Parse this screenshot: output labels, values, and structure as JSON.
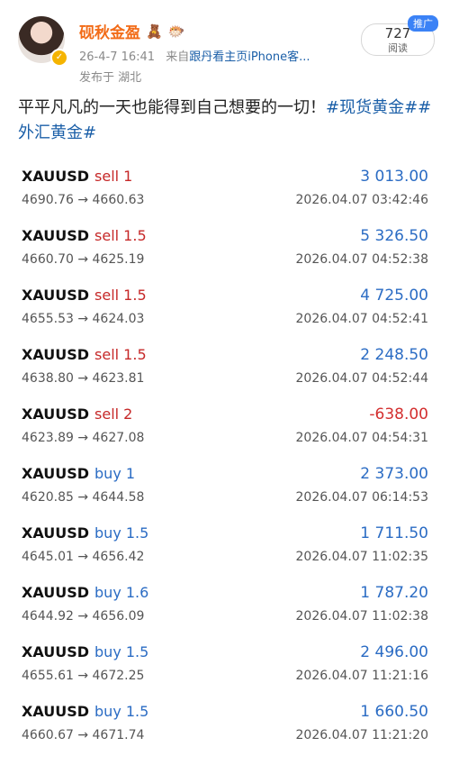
{
  "user": {
    "name": "砚秋金盈",
    "emoji1": "🧸",
    "emoji2": "🐡",
    "post_time": "26-4-7 16:41",
    "source_prefix": "来自",
    "source": "跟丹看主页iPhone客...",
    "location": "发布于 湖北"
  },
  "reads": {
    "count": "727",
    "label": "阅读",
    "badge": "推广"
  },
  "post": {
    "text": "平平凡凡的一天也能得到自己想要的一切！",
    "tags": "#现货黄金##外汇黄金#"
  },
  "trades": [
    {
      "symbol": "XAUUSD",
      "action": "sell 1",
      "type": "sell",
      "profit": "3 013.00",
      "prices": "4690.76 → 4660.63",
      "time": "2026.04.07 03:42:46"
    },
    {
      "symbol": "XAUUSD",
      "action": "sell 1.5",
      "type": "sell",
      "profit": "5 326.50",
      "prices": "4660.70 → 4625.19",
      "time": "2026.04.07 04:52:38"
    },
    {
      "symbol": "XAUUSD",
      "action": "sell 1.5",
      "type": "sell",
      "profit": "4 725.00",
      "prices": "4655.53 → 4624.03",
      "time": "2026.04.07 04:52:41"
    },
    {
      "symbol": "XAUUSD",
      "action": "sell 1.5",
      "type": "sell",
      "profit": "2 248.50",
      "prices": "4638.80 → 4623.81",
      "time": "2026.04.07 04:52:44"
    },
    {
      "symbol": "XAUUSD",
      "action": "sell 2",
      "type": "sell",
      "profit": "-638.00",
      "prices": "4623.89 → 4627.08",
      "time": "2026.04.07 04:54:31"
    },
    {
      "symbol": "XAUUSD",
      "action": "buy 1",
      "type": "buy",
      "profit": "2 373.00",
      "prices": "4620.85 → 4644.58",
      "time": "2026.04.07 06:14:53"
    },
    {
      "symbol": "XAUUSD",
      "action": "buy 1.5",
      "type": "buy",
      "profit": "1 711.50",
      "prices": "4645.01 → 4656.42",
      "time": "2026.04.07 11:02:35"
    },
    {
      "symbol": "XAUUSD",
      "action": "buy 1.6",
      "type": "buy",
      "profit": "1 787.20",
      "prices": "4644.92 → 4656.09",
      "time": "2026.04.07 11:02:38"
    },
    {
      "symbol": "XAUUSD",
      "action": "buy 1.5",
      "type": "buy",
      "profit": "2 496.00",
      "prices": "4655.61 → 4672.25",
      "time": "2026.04.07 11:21:16"
    },
    {
      "symbol": "XAUUSD",
      "action": "buy 1.5",
      "type": "buy",
      "profit": "1 660.50",
      "prices": "4660.67 → 4671.74",
      "time": "2026.04.07 11:21:20"
    }
  ]
}
